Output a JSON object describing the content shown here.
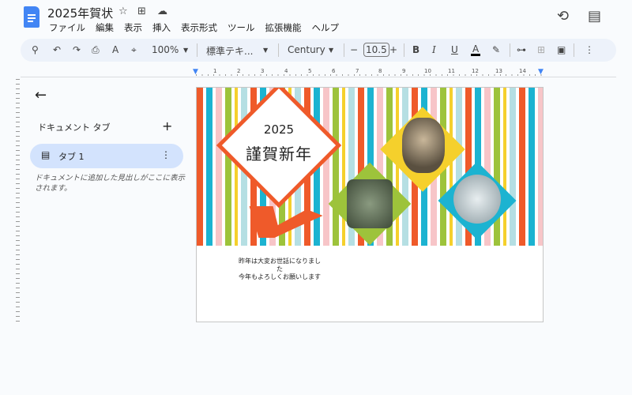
{
  "doc": {
    "title": "2025年賀状"
  },
  "menu": [
    "ファイル",
    "編集",
    "表示",
    "挿入",
    "表示形式",
    "ツール",
    "拡張機能",
    "ヘルプ"
  ],
  "toolbar": {
    "zoom": "100%",
    "style": "標準テキ...",
    "font": "Century",
    "size": "10.5",
    "bold": "B",
    "italic": "I",
    "underline": "U",
    "textcolor": "A",
    "textcolor_value": "#000000"
  },
  "ruler": [
    "1",
    "2",
    "3",
    "4",
    "5",
    "6",
    "7",
    "8",
    "9",
    "10",
    "11",
    "12",
    "13",
    "14"
  ],
  "sidebar": {
    "heading": "ドキュメント タブ",
    "tab": "タブ 1",
    "help": "ドキュメントに追加した見出しがここに表示されます。"
  },
  "card": {
    "year": "2025",
    "greeting": "謹賀新年"
  },
  "body": {
    "line1": "昨年は大変お世話になりまし",
    "line2": "た",
    "line3": "今年もよろしくお願いします"
  },
  "colors": {
    "accent": "#ef5a2a",
    "doc_blue": "#4285f4",
    "tab_bg": "#d3e3fd"
  }
}
